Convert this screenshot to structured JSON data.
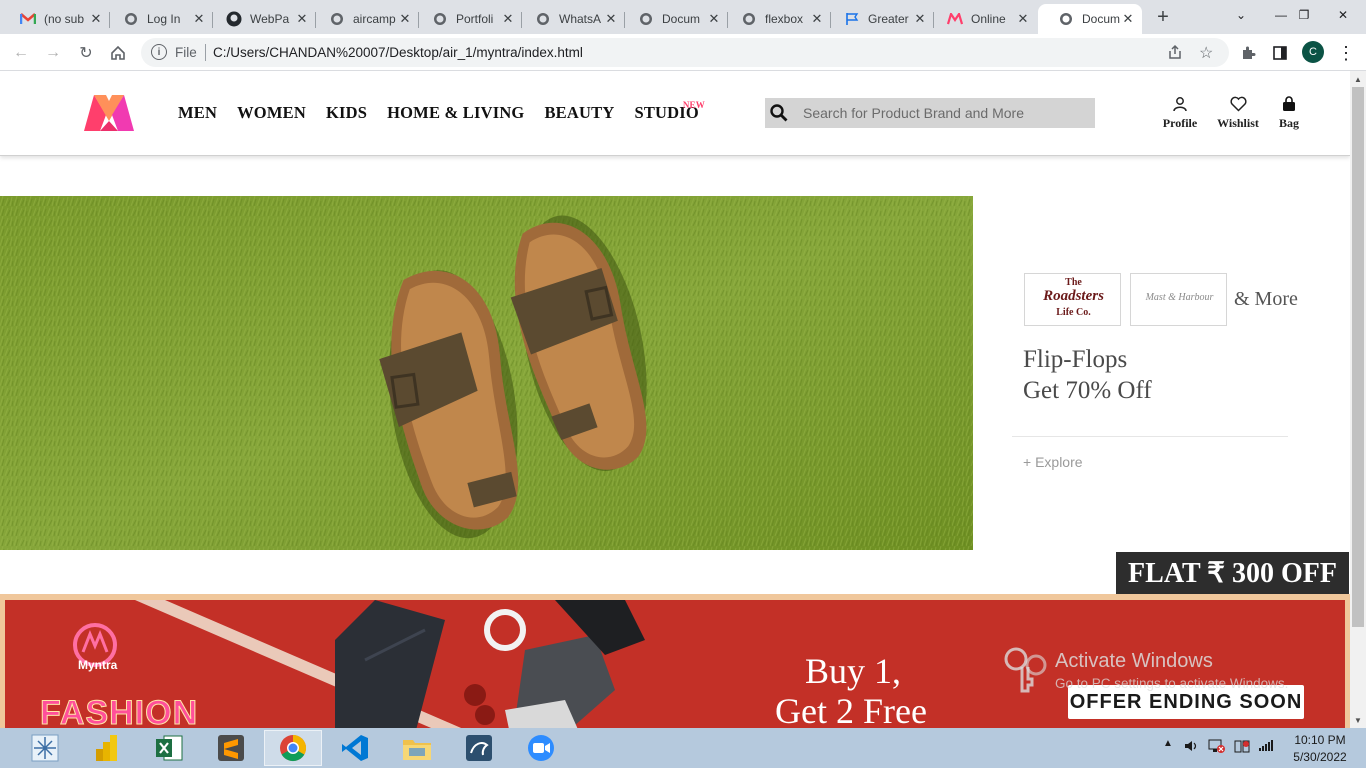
{
  "browser": {
    "tabs": [
      {
        "label": "(no sub",
        "icon": "gmail-icon"
      },
      {
        "label": "Log In",
        "icon": "globe-icon"
      },
      {
        "label": "WebPa",
        "icon": "github-icon"
      },
      {
        "label": "aircamp",
        "icon": "globe-icon"
      },
      {
        "label": "Portfoli",
        "icon": "globe-icon"
      },
      {
        "label": "WhatsA",
        "icon": "globe-icon"
      },
      {
        "label": "Docum",
        "icon": "globe-icon"
      },
      {
        "label": "flexbox",
        "icon": "globe-icon"
      },
      {
        "label": "Greater",
        "icon": "flag-icon"
      },
      {
        "label": "Online",
        "icon": "myntra-icon"
      },
      {
        "label": "Docum",
        "icon": "globe-icon",
        "active": true
      }
    ],
    "omnibox": {
      "file_label": "File",
      "url": "C:/Users/CHANDAN%20007/Desktop/air_1/myntra/index.html"
    },
    "profile_initial": "C"
  },
  "site": {
    "nav": [
      "MEN",
      "WOMEN",
      "KIDS",
      "HOME & LIVING",
      "BEAUTY",
      "STUDIO"
    ],
    "studio_tag": "NEW",
    "search_placeholder": "Search for Product Brand and More",
    "actions": {
      "profile": "Profile",
      "wishlist": "Wishlist",
      "bag": "Bag"
    },
    "brand_color": "#ff3f6c"
  },
  "banner": {
    "brand1_line1": "The",
    "brand1_line2": "Roadsters",
    "brand1_line3": "Life Co.",
    "brand2": "Mast & Harbour",
    "more": "& More",
    "line1": "Flip-Flops",
    "line2": "Get 70% Off",
    "explore": "+ Explore"
  },
  "flat_off": "FLAT ₹ 300 OFF",
  "banner2": {
    "brand": "Myntra",
    "fashion": "FASHION",
    "buy_line1": "Buy 1,",
    "buy_line2": "Get 2 Free",
    "offer": "OFFER ENDING SOON"
  },
  "watermark": {
    "title": "Activate Windows",
    "subtitle": "Go to PC settings to activate Windows."
  },
  "taskbar": {
    "apps": [
      "windows-start-icon",
      "power-bi-icon",
      "excel-icon",
      "sublime-text-icon",
      "chrome-icon",
      "vscode-icon",
      "file-explorer-icon",
      "mysql-workbench-icon",
      "zoom-icon"
    ],
    "time": "10:10 PM",
    "date": "5/30/2022"
  }
}
